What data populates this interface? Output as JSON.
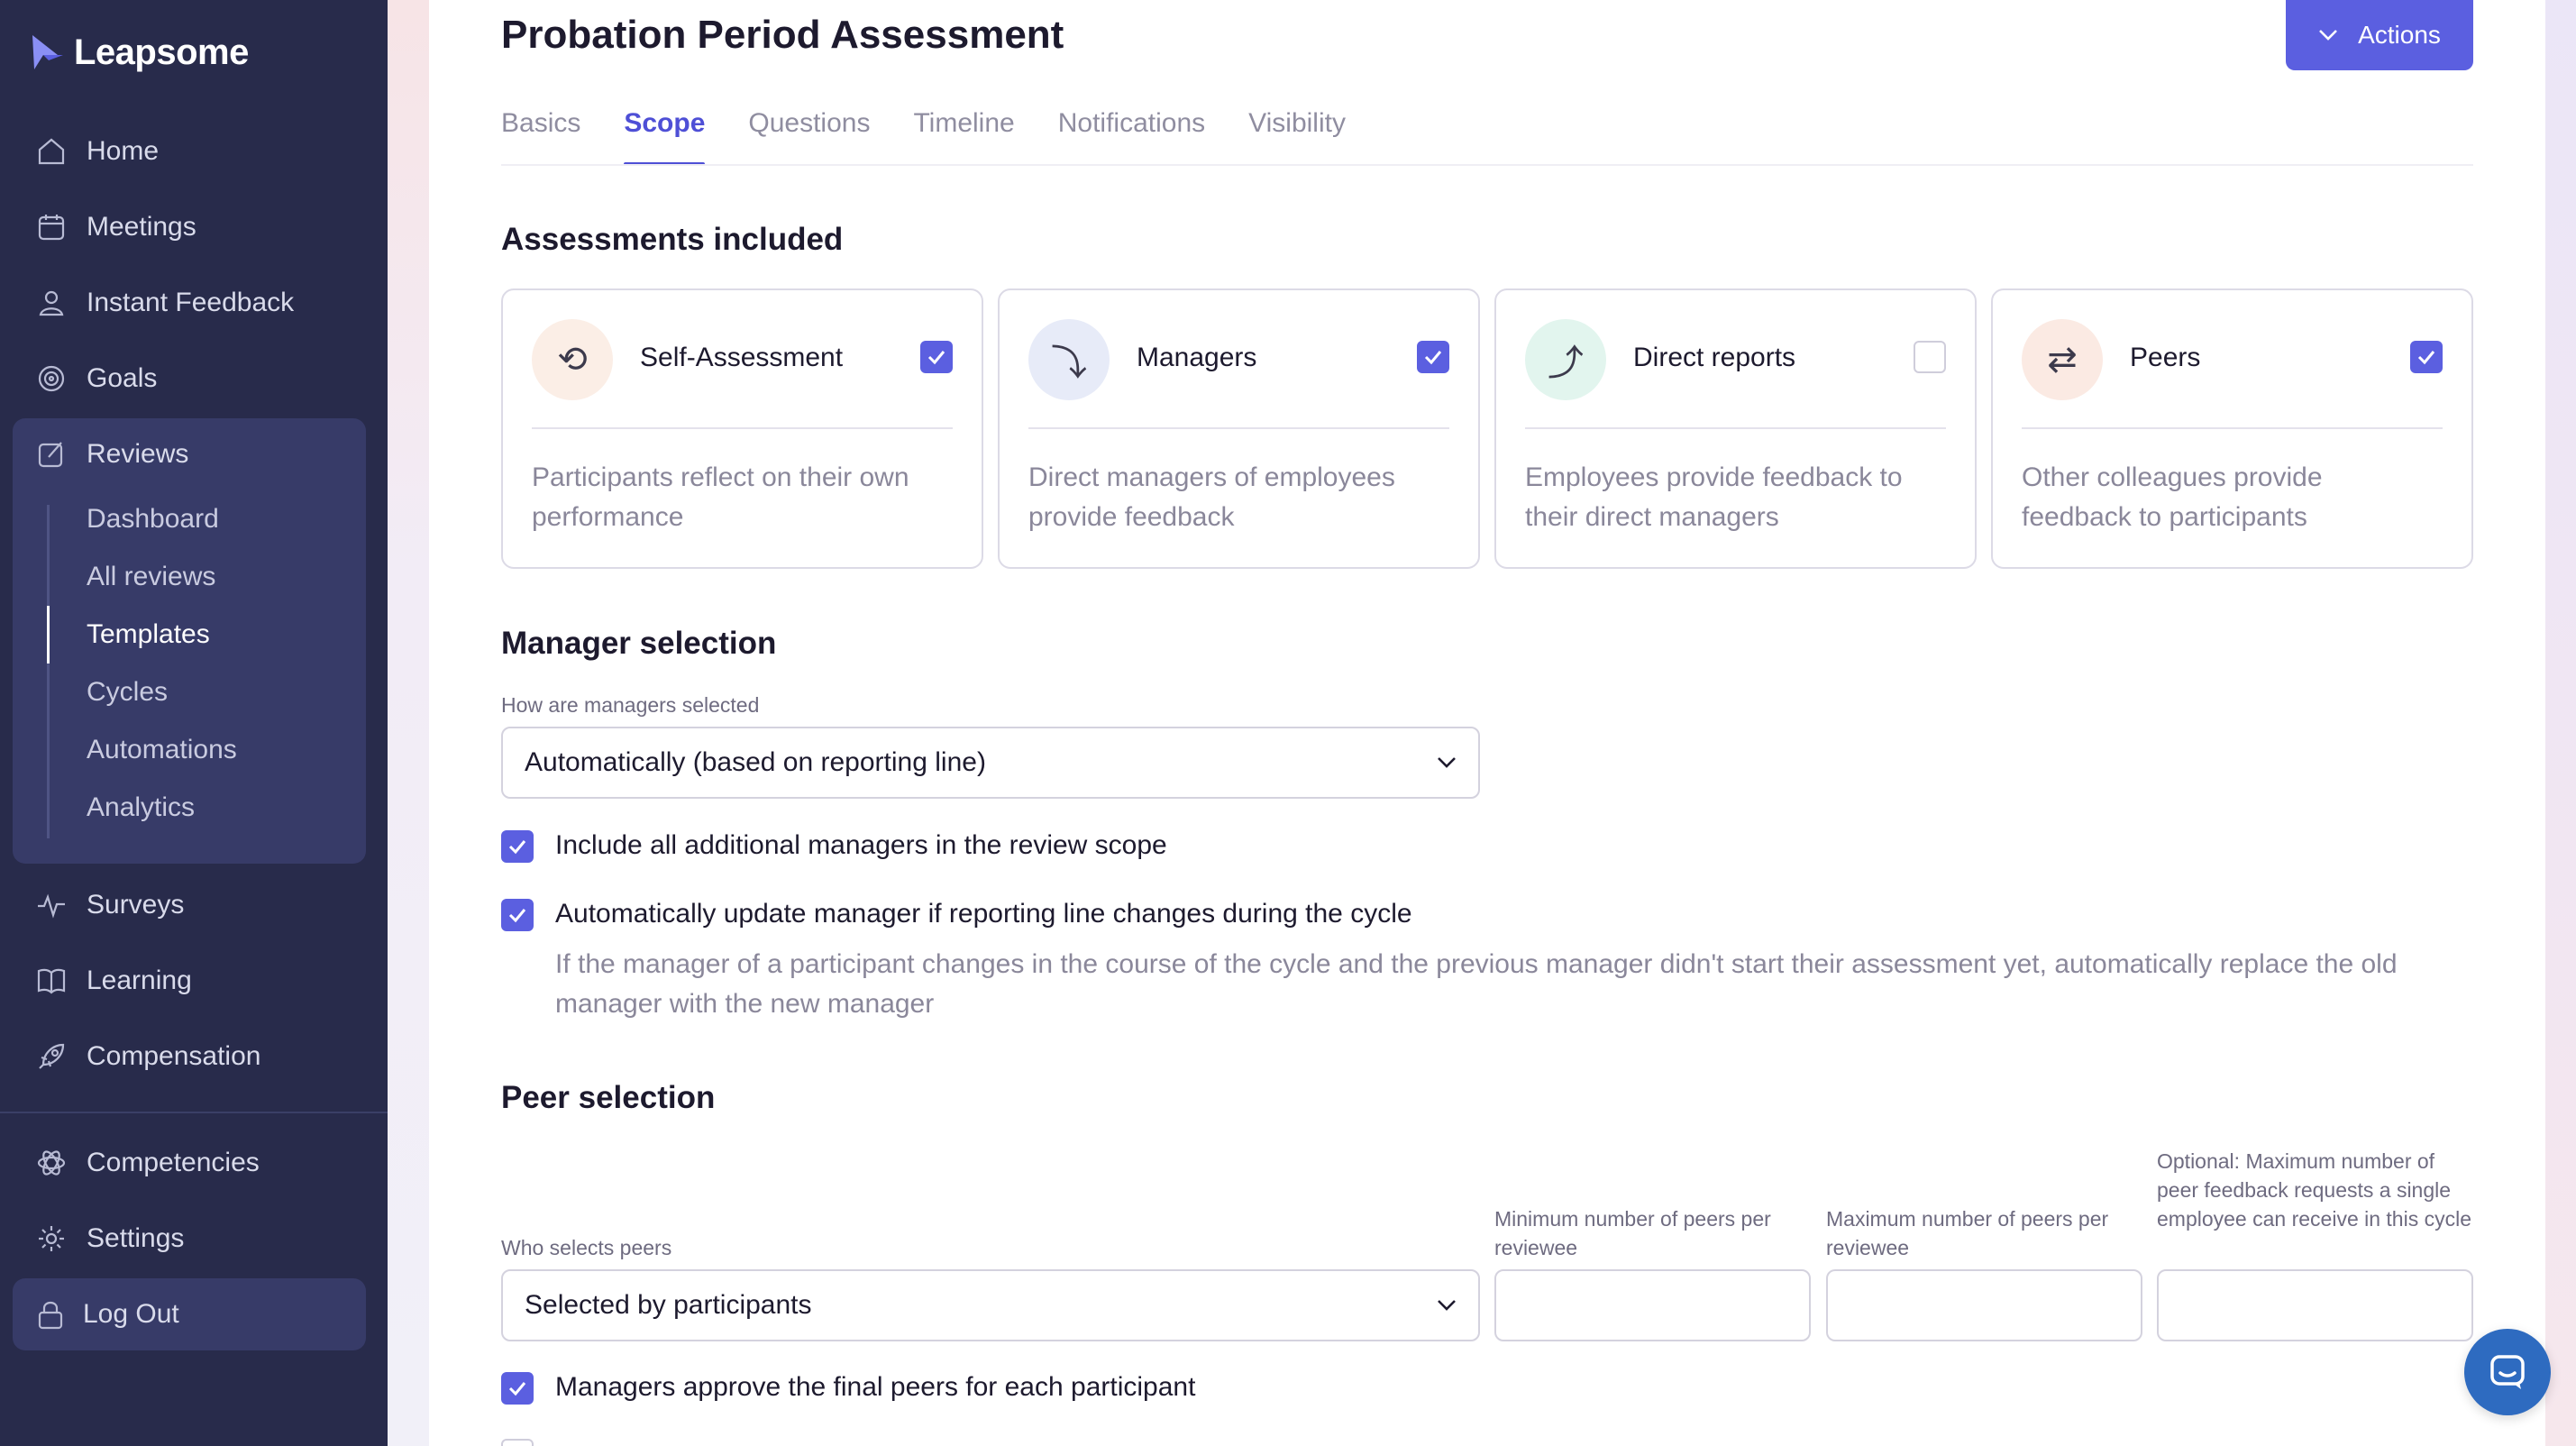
{
  "app": {
    "logo_text": "Leapsome"
  },
  "sidebar": {
    "items": [
      {
        "label": "Home",
        "icon": "home-icon"
      },
      {
        "label": "Meetings",
        "icon": "calendar-icon"
      },
      {
        "label": "Instant Feedback",
        "icon": "feedback-icon"
      },
      {
        "label": "Goals",
        "icon": "target-icon"
      },
      {
        "label": "Reviews",
        "icon": "edit-icon"
      },
      {
        "label": "Surveys",
        "icon": "pulse-icon"
      },
      {
        "label": "Learning",
        "icon": "book-icon"
      },
      {
        "label": "Compensation",
        "icon": "rocket-icon"
      },
      {
        "label": "Competencies",
        "icon": "atom-icon"
      },
      {
        "label": "Settings",
        "icon": "gear-icon"
      }
    ],
    "reviews_sub": [
      "Dashboard",
      "All reviews",
      "Templates",
      "Cycles",
      "Automations",
      "Analytics"
    ],
    "reviews_active_sub": "Templates",
    "logout": "Log Out"
  },
  "header": {
    "title": "Probation Period Assessment",
    "actions_label": "Actions"
  },
  "tabs": [
    {
      "label": "Basics",
      "active": false
    },
    {
      "label": "Scope",
      "active": true
    },
    {
      "label": "Questions",
      "active": false
    },
    {
      "label": "Timeline",
      "active": false
    },
    {
      "label": "Notifications",
      "active": false
    },
    {
      "label": "Visibility",
      "active": false
    }
  ],
  "assessments": {
    "title": "Assessments included",
    "cards": [
      {
        "label": "Self-Assessment",
        "checked": true,
        "glyph": "⟲",
        "icon": "self-assessment-icon",
        "description": "Participants reflect on their own performance",
        "color": "#fbeee6"
      },
      {
        "label": "Managers",
        "checked": true,
        "glyph": "⤵",
        "icon": "managers-icon",
        "description": "Direct managers of employees provide feedback",
        "color": "#e7ebf8"
      },
      {
        "label": "Direct reports",
        "checked": false,
        "glyph": "⤴",
        "icon": "direct-reports-icon",
        "description": "Employees provide feedback to their direct managers",
        "color": "#e2f5ee"
      },
      {
        "label": "Peers",
        "checked": true,
        "glyph": "⇄",
        "icon": "peers-icon",
        "description": "Other colleagues provide feedback to participants",
        "color": "#fbeae3"
      }
    ]
  },
  "manager_selection": {
    "title": "Manager selection",
    "field_label": "How are managers selected",
    "selected_value": "Automatically (based on reporting line)",
    "include_additional_label": "Include all additional managers in the review scope",
    "auto_update_label": "Automatically update manager if reporting line changes during the cycle",
    "auto_update_help": "If the manager of a participant changes in the course of the cycle and the previous manager didn't start their assessment yet, automatically replace the old manager with the new manager"
  },
  "peer_selection": {
    "title": "Peer selection",
    "who_selects_label": "Who selects peers",
    "who_selects_value": "Selected by participants",
    "min_label": "Minimum number of peers per reviewee",
    "max_label": "Maximum number of peers per reviewee",
    "max_requests_label": "Optional: Maximum number of peer feedback requests a single employee can receive in this cycle",
    "min_value": "",
    "max_value": "",
    "max_requests_value": "",
    "managers_approve_label": "Managers approve the final peers for each participant"
  },
  "colors": {
    "sidebar_bg": "#282b4b",
    "accent": "#5b5fe0",
    "chat_button": "#2e6bc0"
  }
}
